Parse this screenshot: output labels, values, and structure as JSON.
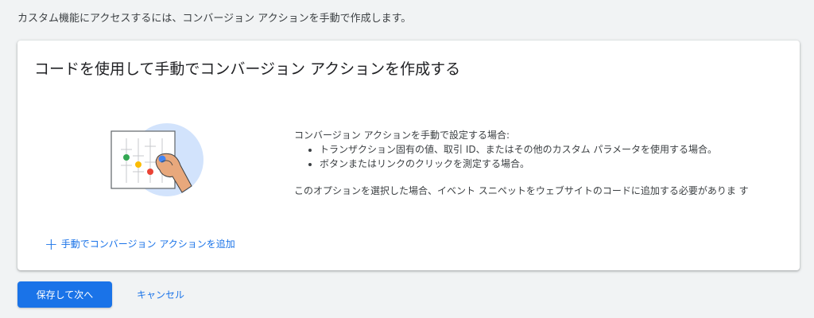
{
  "intro_text": "カスタム機能にアクセスするには、コンバージョン アクションを手動で作成します。",
  "card": {
    "title": "コードを使用して手動でコンバージョン アクションを作成する",
    "description": {
      "lead": "コンバージョン アクションを手動で設定する場合:",
      "bullets": [
        "トランザクション固有の値、取引 ID、またはその他のカスタム パラメータを使用する場合。",
        "ボタンまたはリンクのクリックを測定する場合。"
      ],
      "note": "このオプションを選択した場合、イベント スニペットをウェブサイトのコードに追加する必要がありま す"
    },
    "add_link": {
      "icon": "plus-icon",
      "label": "手動でコンバージョン アクションを追加"
    }
  },
  "footer": {
    "save_label": "保存して次へ",
    "cancel_label": "キャンセル"
  },
  "colors": {
    "accent": "#1a73e8",
    "page_bg": "#f1f3f4",
    "illustration_circle": "#d2e3fc",
    "dot_green": "#34a853",
    "dot_yellow": "#fbbc04",
    "dot_red": "#ea4335",
    "dot_blue": "#4285f4"
  }
}
